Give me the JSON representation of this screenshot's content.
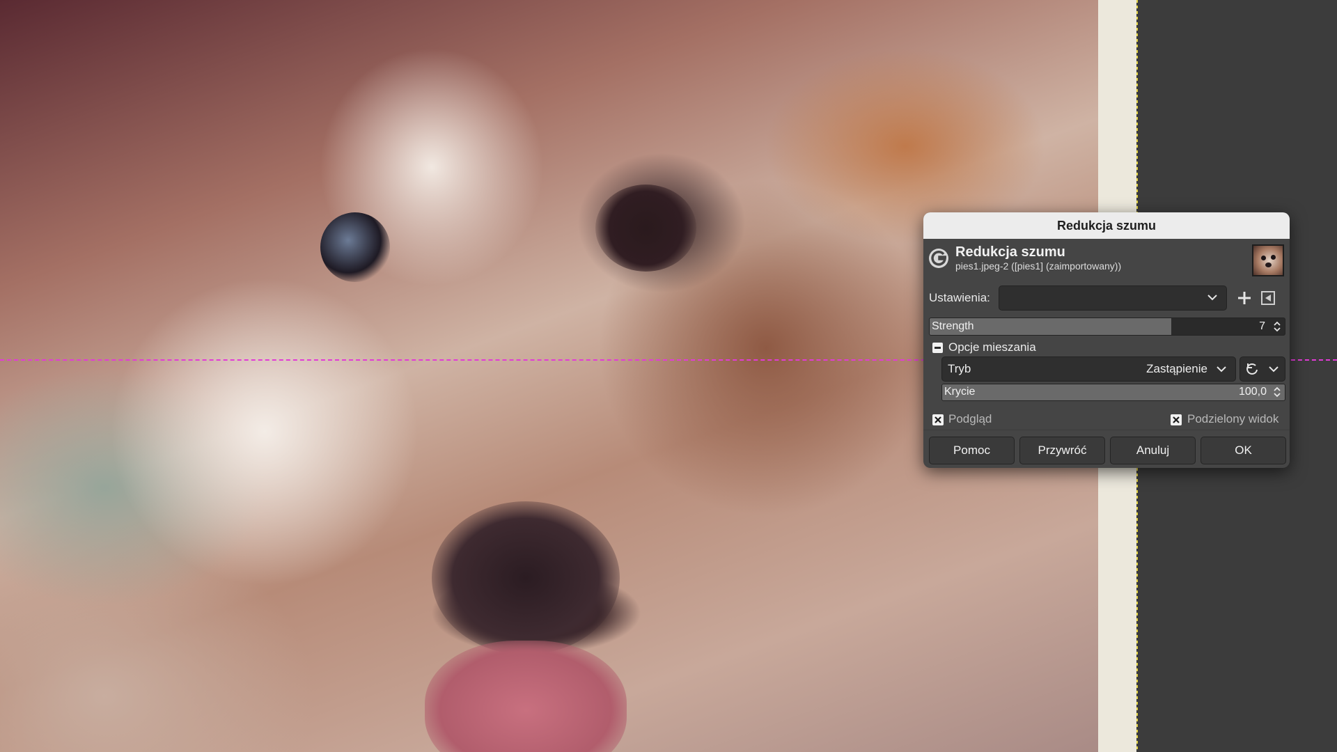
{
  "dialog": {
    "window_title": "Redukcja szumu",
    "header_title": "Redukcja szumu",
    "header_subtitle": "pies1.jpeg-2 ([pies1] (zaimportowany))",
    "settings_label": "Ustawienia:",
    "settings_value": "",
    "strength": {
      "label": "Strength",
      "value": "7",
      "fill_fraction": 0.68
    },
    "blending": {
      "section_label": "Opcje mieszania",
      "mode_label": "Tryb",
      "mode_value": "Zastąpienie",
      "opacity_label": "Krycie",
      "opacity_value": "100,0"
    },
    "preview_label": "Podgląd",
    "split_view_label": "Podzielony widok",
    "buttons": {
      "help": "Pomoc",
      "reset": "Przywróć",
      "cancel": "Anuluj",
      "ok": "OK"
    }
  },
  "icons": {
    "app": "gimp-icon",
    "thumbnail": "image-thumbnail",
    "add": "plus-icon",
    "reset_settings": "reset-icon"
  },
  "colors": {
    "guide": "#e23bd6",
    "canvas_border": "#e4d445",
    "dialog_bg": "#454545"
  }
}
